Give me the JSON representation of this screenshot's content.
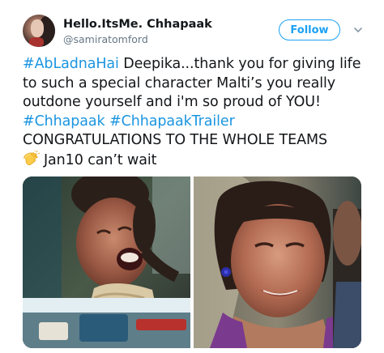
{
  "user": {
    "display_name": "Hello.ItsMe. Chhapaak",
    "handle": "@samiratomford"
  },
  "follow_button": {
    "label": "Follow"
  },
  "tweet": {
    "segments": [
      {
        "text": "#AbLadnaHai",
        "type": "hashtag"
      },
      {
        "text": " Deepika...thank you for giving life to such a special character Malti’s you really outdone yourself and i'm so proud of YOU! ",
        "type": "text"
      },
      {
        "text": "#Chhapaak",
        "type": "hashtag"
      },
      {
        "text": " ",
        "type": "text"
      },
      {
        "text": "#ChhapaakTrailer",
        "type": "hashtag"
      },
      {
        "text": " CONGRATULATIONS TO THE WHOLE TEAMS ",
        "type": "text"
      },
      {
        "text": "Jan10 can’t wait",
        "type": "text"
      }
    ]
  },
  "colors": {
    "link": "#1b95e0",
    "follow_blue": "#1da1f2",
    "secondary_text": "#657786"
  },
  "icons": {
    "clap": "clapping-hands-emoji",
    "chevron": "chevron-down-icon"
  }
}
